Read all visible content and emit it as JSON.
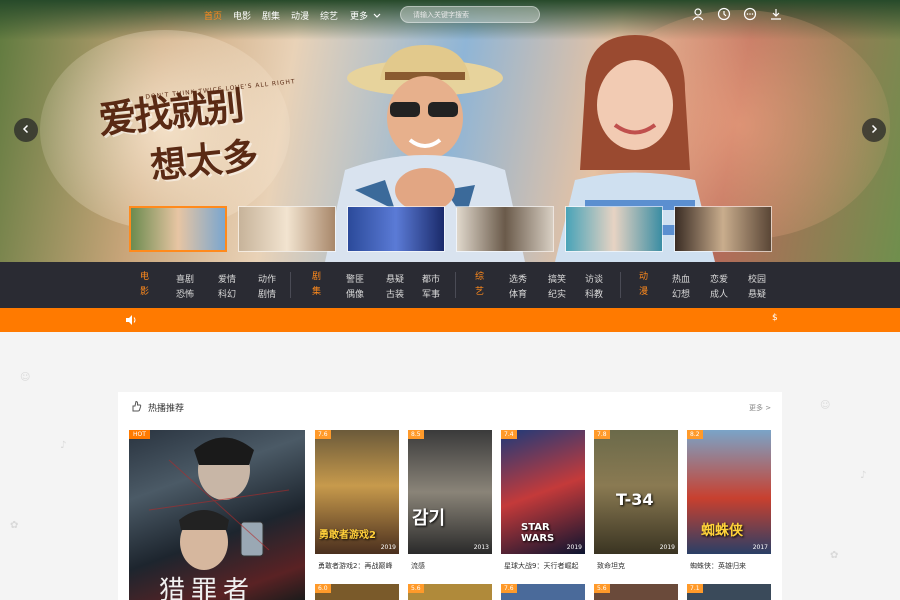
{
  "nav": {
    "items": [
      "首页",
      "电影",
      "剧集",
      "动漫",
      "综艺",
      "更多"
    ],
    "search_placeholder": "请输入关键字搜索"
  },
  "hero": {
    "title_line1": "爱找就别",
    "title_line2": "想太多",
    "subtitle": "DON'T THINK TWICE LOVE'S ALL RIGHT"
  },
  "categories": [
    {
      "head": "电影",
      "links": [
        "喜剧",
        "爱情",
        "动作",
        "恐怖",
        "科幻",
        "剧情"
      ]
    },
    {
      "head": "剧集",
      "links": [
        "警匪",
        "悬疑",
        "都市",
        "偶像",
        "古装",
        "军事"
      ]
    },
    {
      "head": "综艺",
      "links": [
        "选秀",
        "搞笑",
        "访谈",
        "体育",
        "纪实",
        "科教"
      ]
    },
    {
      "head": "动漫",
      "links": [
        "热血",
        "恋爱",
        "校园",
        "幻想",
        "成人",
        "悬疑"
      ]
    }
  ],
  "notice": {
    "mark": "$"
  },
  "section": {
    "title": "热播推荐",
    "more": "更多 >",
    "featured": {
      "badge": "HOT",
      "title": "猎罪者"
    },
    "posters": [
      {
        "score": "7.6",
        "year": "2019",
        "caption": "勇敢者游戏2：再战巅峰",
        "art": "勇敢者游戏2"
      },
      {
        "score": "8.5",
        "year": "2013",
        "caption": "流感",
        "art": "감기"
      },
      {
        "score": "7.4",
        "year": "2019",
        "caption": "星球大战9：天行者崛起",
        "art": "STAR WARS"
      },
      {
        "score": "7.8",
        "year": "2019",
        "caption": "致命坦克",
        "art": "T-34"
      },
      {
        "score": "8.2",
        "year": "2017",
        "caption": "蜘蛛侠：英雄归来",
        "art": "蜘蛛侠"
      }
    ],
    "row2_scores": [
      "6.0",
      "5.6",
      "7.6",
      "5.6",
      "7.1"
    ]
  }
}
